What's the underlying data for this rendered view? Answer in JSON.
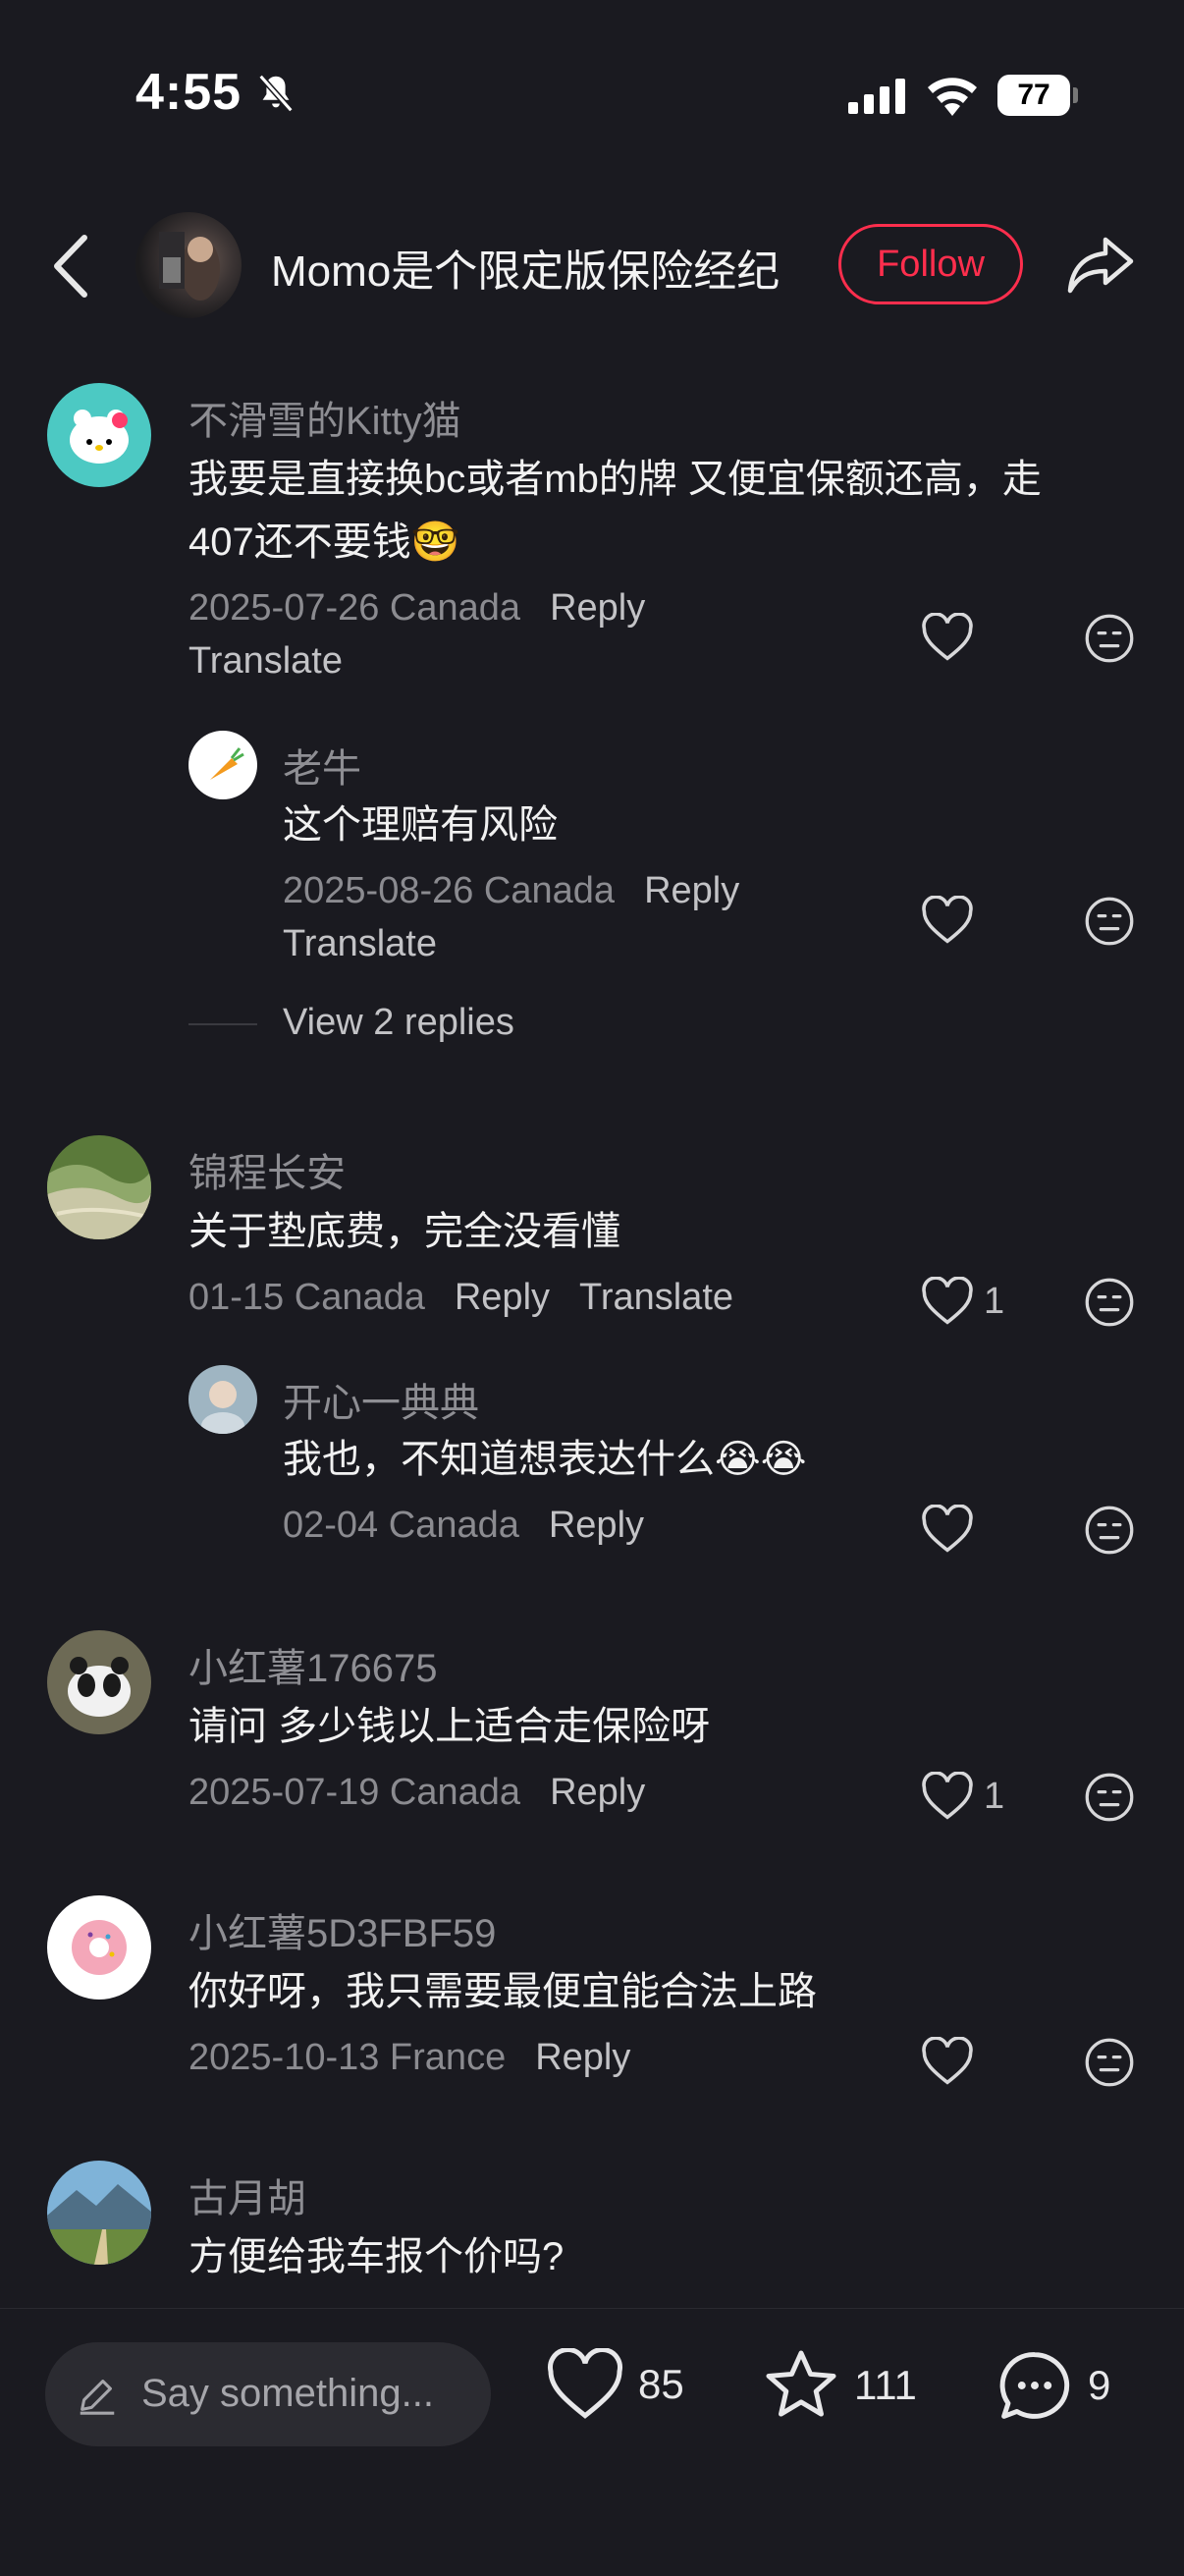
{
  "status_bar": {
    "time": "4:55",
    "battery": "77"
  },
  "header": {
    "author": "Momo是个限定版保险经纪",
    "follow_label": "Follow"
  },
  "comments": [
    {
      "user": "不滑雪的Kitty猫",
      "text_line1": "我要是直接换bc或者mb的牌 又便宜保额还高，走",
      "text_line2": "407还不要钱🤓",
      "date": "2025-07-26 Canada",
      "reply": "Reply",
      "translate": "Translate",
      "likes": "",
      "replies": [
        {
          "user": "老牛",
          "text": "这个理赔有风险",
          "date": "2025-08-26 Canada",
          "reply": "Reply",
          "translate": "Translate",
          "likes": ""
        }
      ],
      "view_replies": "View 2 replies"
    },
    {
      "user": "锦程长安",
      "text": "关于垫底费，完全没看懂",
      "date": "01-15 Canada",
      "reply": "Reply",
      "translate": "Translate",
      "likes": "1",
      "replies": [
        {
          "user": "开心一典典",
          "text": "我也，不知道想表达什么😭😭",
          "date": "02-04 Canada",
          "reply": "Reply",
          "likes": ""
        }
      ]
    },
    {
      "user": "小红薯176675",
      "text": "请问 多少钱以上适合走保险呀",
      "date": "2025-07-19 Canada",
      "reply": "Reply",
      "likes": "1"
    },
    {
      "user": "小红薯5D3FBF59",
      "text": "你好呀，我只需要最便宜能合法上路",
      "date": "2025-10-13 France",
      "reply": "Reply",
      "likes": ""
    },
    {
      "user": "古月胡",
      "text": "方便给我车报个价吗?"
    }
  ],
  "bottom_bar": {
    "placeholder": "Say something...",
    "likes": "85",
    "stars": "111",
    "comments": "9"
  },
  "colors": {
    "background": "#1a1a20",
    "accent": "#ff2e4d"
  }
}
